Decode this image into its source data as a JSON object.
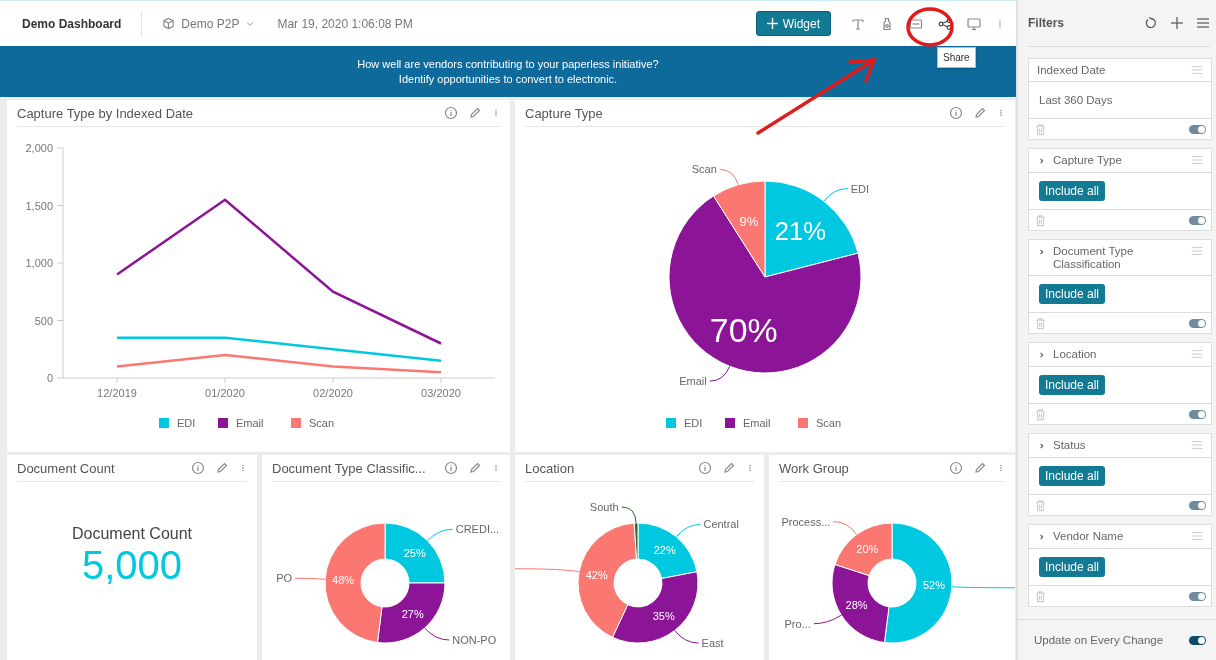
{
  "header": {
    "title": "Demo Dashboard",
    "data_source": "Demo P2P",
    "timestamp": "Mar 19, 2020 1:06:08 PM",
    "add_button": "Widget"
  },
  "tooltip": {
    "text": "Share"
  },
  "banner": {
    "lines": [
      "How well are vendors contributing to your paperless initiative?",
      "Identify opportunities to convert to electronic."
    ]
  },
  "widgets": [
    {
      "kind": "chart",
      "title": "Capture Type by Indexed Date",
      "chart_data": {
        "type": "line",
        "legend": "bottom",
        "x": [
          "12/2019",
          "01/2020",
          "02/2020",
          "03/2020"
        ],
        "ylim": [
          0,
          2000
        ],
        "yticks": [
          {
            "value": 0,
            "label": "0"
          },
          {
            "value": 500,
            "label": "500"
          },
          {
            "value": 1000,
            "label": "1,000"
          },
          {
            "value": 1500,
            "label": "1,500"
          },
          {
            "value": 2000,
            "label": "2,000"
          }
        ],
        "series": [
          {
            "name": "EDI",
            "color": "#00c8e0",
            "values": [
              350,
              350,
              250,
              150
            ]
          },
          {
            "name": "Email",
            "color": "#8b1497",
            "values": [
              900,
              1550,
              750,
              300
            ]
          },
          {
            "name": "Scan",
            "color": "#fa7871",
            "values": [
              100,
              200,
              100,
              50
            ]
          }
        ]
      }
    },
    {
      "kind": "chart",
      "title": "Capture Type",
      "chart_data": {
        "type": "pie",
        "legend": "bottom",
        "categories": [
          "EDI",
          "Email",
          "Scan"
        ],
        "colors": [
          "#00c8e0",
          "#8b1497",
          "#fa7871"
        ],
        "values": [
          21,
          70,
          9
        ],
        "value_labels": [
          "21%",
          "70%",
          "9%"
        ]
      }
    },
    {
      "kind": "count",
      "title": "Document Count",
      "label": "Document Count",
      "value": "5,000"
    },
    {
      "kind": "chart",
      "title": "Document Type Classific...",
      "chart_data": {
        "type": "donut",
        "categories": [
          "CREDI...",
          "NON-PO",
          "PO"
        ],
        "colors": [
          "#00c8e0",
          "#8b1497",
          "#fa7871"
        ],
        "values": [
          25,
          27,
          48
        ],
        "value_labels": [
          "25%",
          "27%",
          "48%"
        ]
      }
    },
    {
      "kind": "chart",
      "title": "Location",
      "chart_data": {
        "type": "donut",
        "categories": [
          "Central",
          "East",
          null,
          "South"
        ],
        "colors": [
          "#00c8e0",
          "#8b1497",
          "#fa7871",
          "#2e6b2e"
        ],
        "values": [
          22,
          35,
          42,
          1
        ],
        "value_labels": [
          "22%",
          "35%",
          "42%",
          null
        ]
      }
    },
    {
      "kind": "chart",
      "title": "Work Group",
      "chart_data": {
        "type": "donut",
        "categories": [
          null,
          "Pro...",
          "Process..."
        ],
        "colors": [
          "#00c8e0",
          "#8b1497",
          "#fa7871"
        ],
        "values": [
          52,
          28,
          20
        ],
        "value_labels": [
          "52%",
          "28%",
          "20%"
        ]
      }
    }
  ],
  "filters": {
    "title": "Filters",
    "items": [
      {
        "title": "Indexed Date",
        "kind": "date",
        "value": "Last 360 Days",
        "on": true
      },
      {
        "title": "Capture Type",
        "kind": "list",
        "button": "Include all",
        "on": true
      },
      {
        "title": "Document Type Classification",
        "kind": "list",
        "button": "Include all",
        "on": true
      },
      {
        "title": "Location",
        "kind": "list",
        "button": "Include all",
        "on": true
      },
      {
        "title": "Status",
        "kind": "list",
        "button": "Include all",
        "on": true
      },
      {
        "title": "Vendor Name",
        "kind": "list",
        "button": "Include all",
        "on": true
      }
    ],
    "footer": {
      "label": "Update on Every Change",
      "on": true
    }
  }
}
